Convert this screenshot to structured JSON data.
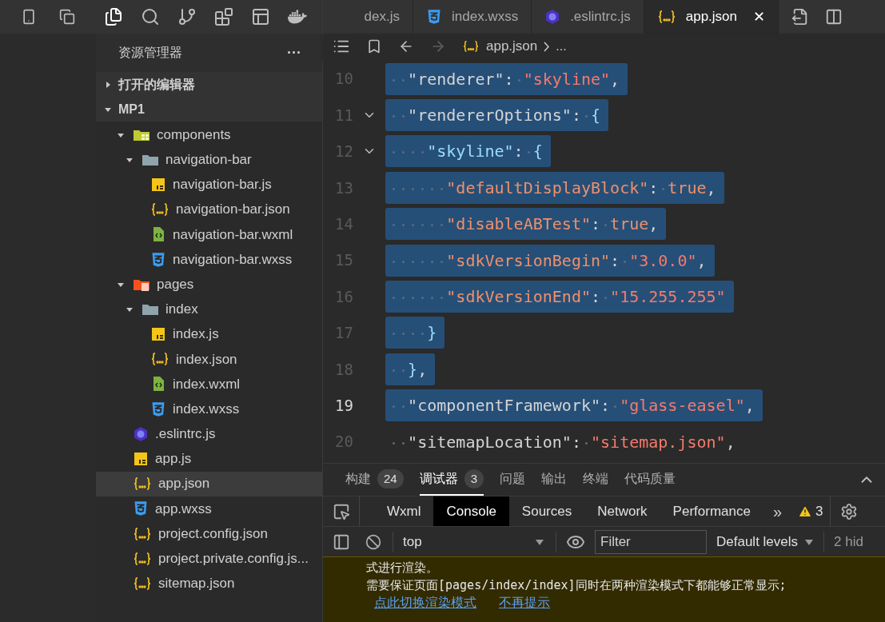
{
  "sidebar": {
    "title": "资源管理器",
    "more": "···",
    "sections": [
      {
        "label": "打开的编辑器",
        "expanded": false
      },
      {
        "label": "MP1",
        "expanded": true
      }
    ],
    "tree": [
      {
        "name": "components",
        "kind": "folder-lib",
        "expanded": true,
        "selected": false,
        "children": [
          {
            "name": "navigation-bar",
            "kind": "folder",
            "expanded": true,
            "selected": false,
            "children": [
              {
                "name": "navigation-bar.js",
                "kind": "js",
                "selected": false
              },
              {
                "name": "navigation-bar.json",
                "kind": "json",
                "selected": false
              },
              {
                "name": "navigation-bar.wxml",
                "kind": "wxml",
                "selected": false
              },
              {
                "name": "navigation-bar.wxss",
                "kind": "wxss",
                "selected": false
              }
            ]
          }
        ]
      },
      {
        "name": "pages",
        "kind": "folder-pages",
        "expanded": true,
        "selected": false,
        "children": [
          {
            "name": "index",
            "kind": "folder",
            "expanded": true,
            "selected": false,
            "children": [
              {
                "name": "index.js",
                "kind": "js",
                "selected": false
              },
              {
                "name": "index.json",
                "kind": "json",
                "selected": false
              },
              {
                "name": "index.wxml",
                "kind": "wxml",
                "selected": false
              },
              {
                "name": "index.wxss",
                "kind": "wxss",
                "selected": false
              }
            ]
          }
        ]
      },
      {
        "name": ".eslintrc.js",
        "kind": "eslint",
        "selected": false
      },
      {
        "name": "app.js",
        "kind": "js",
        "selected": false
      },
      {
        "name": "app.json",
        "kind": "json",
        "selected": true
      },
      {
        "name": "app.wxss",
        "kind": "wxss",
        "selected": false
      },
      {
        "name": "project.config.json",
        "kind": "json",
        "selected": false
      },
      {
        "name": "project.private.config.js...",
        "kind": "json",
        "selected": false
      },
      {
        "name": "sitemap.json",
        "kind": "json",
        "selected": false
      }
    ]
  },
  "tabs": [
    {
      "label": "dex.js",
      "selected": false
    },
    {
      "label": "index.wxss",
      "kind": "wxss",
      "selected": false
    },
    {
      "label": ".eslintrc.js",
      "kind": "eslint",
      "selected": false
    },
    {
      "label": "app.json",
      "kind": "json",
      "selected": true,
      "close": "✕"
    }
  ],
  "breadcrumb": {
    "file": "app.json",
    "rest": "..."
  },
  "code": [
    {
      "number": "10",
      "selected": true,
      "current": false,
      "fold": false,
      "tokens": [
        {
          "kind": "key0",
          "text": "  \"renderer\""
        },
        {
          "kind": "punct",
          "text": ": "
        },
        {
          "kind": "str",
          "text": "\"skyline\""
        },
        {
          "kind": "punct",
          "text": ","
        }
      ]
    },
    {
      "number": "11",
      "selected": true,
      "current": false,
      "fold": true,
      "tokens": [
        {
          "kind": "key0",
          "text": "  \"rendererOptions\""
        },
        {
          "kind": "punct",
          "text": ": "
        },
        {
          "kind": "brace",
          "text": "{"
        }
      ]
    },
    {
      "number": "12",
      "selected": true,
      "current": false,
      "fold": true,
      "tokens": [
        {
          "kind": "key1",
          "text": "    \"skyline\""
        },
        {
          "kind": "punct",
          "text": ": "
        },
        {
          "kind": "brace",
          "text": "{"
        }
      ]
    },
    {
      "number": "13",
      "selected": true,
      "current": false,
      "fold": false,
      "tokens": [
        {
          "kind": "key2",
          "text": "      \"defaultDisplayBlock\""
        },
        {
          "kind": "punct",
          "text": ": "
        },
        {
          "kind": "bool",
          "text": "true"
        },
        {
          "kind": "punct",
          "text": ","
        }
      ]
    },
    {
      "number": "14",
      "selected": true,
      "current": false,
      "fold": false,
      "tokens": [
        {
          "kind": "key2",
          "text": "      \"disableABTest\""
        },
        {
          "kind": "punct",
          "text": ": "
        },
        {
          "kind": "bool",
          "text": "true"
        },
        {
          "kind": "punct",
          "text": ","
        }
      ]
    },
    {
      "number": "15",
      "selected": true,
      "current": false,
      "fold": false,
      "tokens": [
        {
          "kind": "key2",
          "text": "      \"sdkVersionBegin\""
        },
        {
          "kind": "punct",
          "text": ": "
        },
        {
          "kind": "str",
          "text": "\"3.0.0\""
        },
        {
          "kind": "punct",
          "text": ","
        }
      ]
    },
    {
      "number": "16",
      "selected": true,
      "current": false,
      "fold": false,
      "tokens": [
        {
          "kind": "key2",
          "text": "      \"sdkVersionEnd\""
        },
        {
          "kind": "punct",
          "text": ": "
        },
        {
          "kind": "str",
          "text": "\"15.255.255\""
        }
      ]
    },
    {
      "number": "17",
      "selected": true,
      "current": false,
      "fold": false,
      "tokens": [
        {
          "kind": "brace",
          "text": "    }"
        }
      ]
    },
    {
      "number": "18",
      "selected": true,
      "current": false,
      "fold": false,
      "tokens": [
        {
          "kind": "brace",
          "text": "  }"
        },
        {
          "kind": "punct",
          "text": ","
        }
      ]
    },
    {
      "number": "19",
      "selected": true,
      "current": true,
      "fold": false,
      "tokens": [
        {
          "kind": "key0",
          "text": "  \"componentFramework\""
        },
        {
          "kind": "punct",
          "text": ": "
        },
        {
          "kind": "str",
          "text": "\"glass-easel\""
        },
        {
          "kind": "punct",
          "text": ","
        }
      ]
    },
    {
      "number": "20",
      "selected": false,
      "current": false,
      "fold": false,
      "tokens": [
        {
          "kind": "key0",
          "text": "  \"sitemapLocation\""
        },
        {
          "kind": "punct",
          "text": ": "
        },
        {
          "kind": "str",
          "text": "\"sitemap.json\""
        },
        {
          "kind": "punct",
          "text": ","
        }
      ]
    }
  ],
  "panel_tabs": [
    {
      "label": "构建",
      "badge": "24",
      "selected": false
    },
    {
      "label": "调试器",
      "badge": "3",
      "selected": true
    },
    {
      "label": "问题",
      "selected": false
    },
    {
      "label": "输出",
      "selected": false
    },
    {
      "label": "终端",
      "selected": false
    },
    {
      "label": "代码质量",
      "selected": false
    }
  ],
  "devtools_tabs": [
    {
      "label": "Wxml",
      "selected": false
    },
    {
      "label": "Console",
      "selected": true
    },
    {
      "label": "Sources",
      "selected": false
    },
    {
      "label": "Network",
      "selected": false
    },
    {
      "label": "Performance",
      "selected": false
    }
  ],
  "devtools_more": "»",
  "warning_count": "3",
  "console_toolbar": {
    "context": "top",
    "filter_placeholder": "Filter",
    "levels": "Default levels",
    "hidden": "2 hid"
  },
  "messages": [
    {
      "kind": "text",
      "text": "式进行渲染。"
    },
    {
      "kind": "text",
      "text": "需要保证页面[pages/index/index]同时在两种渲染模式下都能够正常显示;"
    },
    {
      "kind": "links",
      "links": [
        "点此切换渲染模式",
        "不再提示"
      ]
    }
  ]
}
